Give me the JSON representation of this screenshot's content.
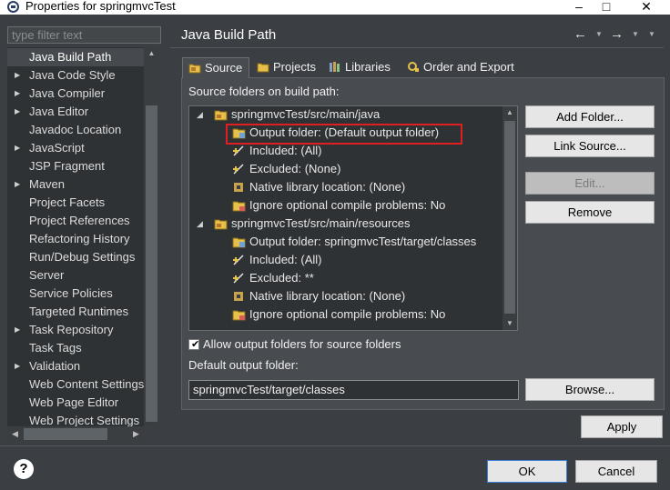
{
  "window": {
    "title": "Properties for springmvcTest"
  },
  "sidebar": {
    "filter_placeholder": "type filter text",
    "items": [
      {
        "label": "Java Build Path",
        "expandable": false,
        "selected": true
      },
      {
        "label": "Java Code Style",
        "expandable": true
      },
      {
        "label": "Java Compiler",
        "expandable": true
      },
      {
        "label": "Java Editor",
        "expandable": true
      },
      {
        "label": "Javadoc Location",
        "expandable": false
      },
      {
        "label": "JavaScript",
        "expandable": true
      },
      {
        "label": "JSP Fragment",
        "expandable": false
      },
      {
        "label": "Maven",
        "expandable": true
      },
      {
        "label": "Project Facets",
        "expandable": false
      },
      {
        "label": "Project References",
        "expandable": false
      },
      {
        "label": "Refactoring History",
        "expandable": false
      },
      {
        "label": "Run/Debug Settings",
        "expandable": false
      },
      {
        "label": "Server",
        "expandable": false
      },
      {
        "label": "Service Policies",
        "expandable": false
      },
      {
        "label": "Targeted Runtimes",
        "expandable": false
      },
      {
        "label": "Task Repository",
        "expandable": true
      },
      {
        "label": "Task Tags",
        "expandable": false
      },
      {
        "label": "Validation",
        "expandable": true
      },
      {
        "label": "Web Content Settings",
        "expandable": false
      },
      {
        "label": "Web Page Editor",
        "expandable": false
      },
      {
        "label": "Web Project Settings",
        "expandable": false
      }
    ]
  },
  "page": {
    "title": "Java Build Path"
  },
  "tabs": [
    {
      "label": "Source",
      "active": true
    },
    {
      "label": "Projects"
    },
    {
      "label": "Libraries"
    },
    {
      "label": "Order and Export"
    }
  ],
  "source": {
    "label": "Source folders on build path:",
    "tree": [
      {
        "label": "springmvcTest/src/main/java",
        "level": 0
      },
      {
        "label": "Output folder: (Default output folder)",
        "level": 1,
        "highlighted": true
      },
      {
        "label": "Included: (All)",
        "level": 1
      },
      {
        "label": "Excluded: (None)",
        "level": 1
      },
      {
        "label": "Native library location: (None)",
        "level": 1
      },
      {
        "label": "Ignore optional compile problems: No",
        "level": 1
      },
      {
        "label": "springmvcTest/src/main/resources",
        "level": 0
      },
      {
        "label": "Output folder: springmvcTest/target/classes",
        "level": 1
      },
      {
        "label": "Included: (All)",
        "level": 1
      },
      {
        "label": "Excluded: **",
        "level": 1
      },
      {
        "label": "Native library location: (None)",
        "level": 1
      },
      {
        "label": "Ignore optional compile problems: No",
        "level": 1
      }
    ],
    "buttons": {
      "add_folder": "Add Folder...",
      "link_source": "Link Source...",
      "edit": "Edit...",
      "remove": "Remove",
      "browse": "Browse..."
    },
    "allow_output_folders_label": "Allow output folders for source folders",
    "allow_output_folders_checked": true,
    "default_output_label": "Default output folder:",
    "default_output_value": "springmvcTest/target/classes"
  },
  "footer": {
    "apply": "Apply",
    "ok": "OK",
    "cancel": "Cancel",
    "help": "?"
  },
  "colors": {
    "panel_bg": "#3b3f43",
    "tree_bg": "#2f3235",
    "highlight_border": "#e02020"
  }
}
